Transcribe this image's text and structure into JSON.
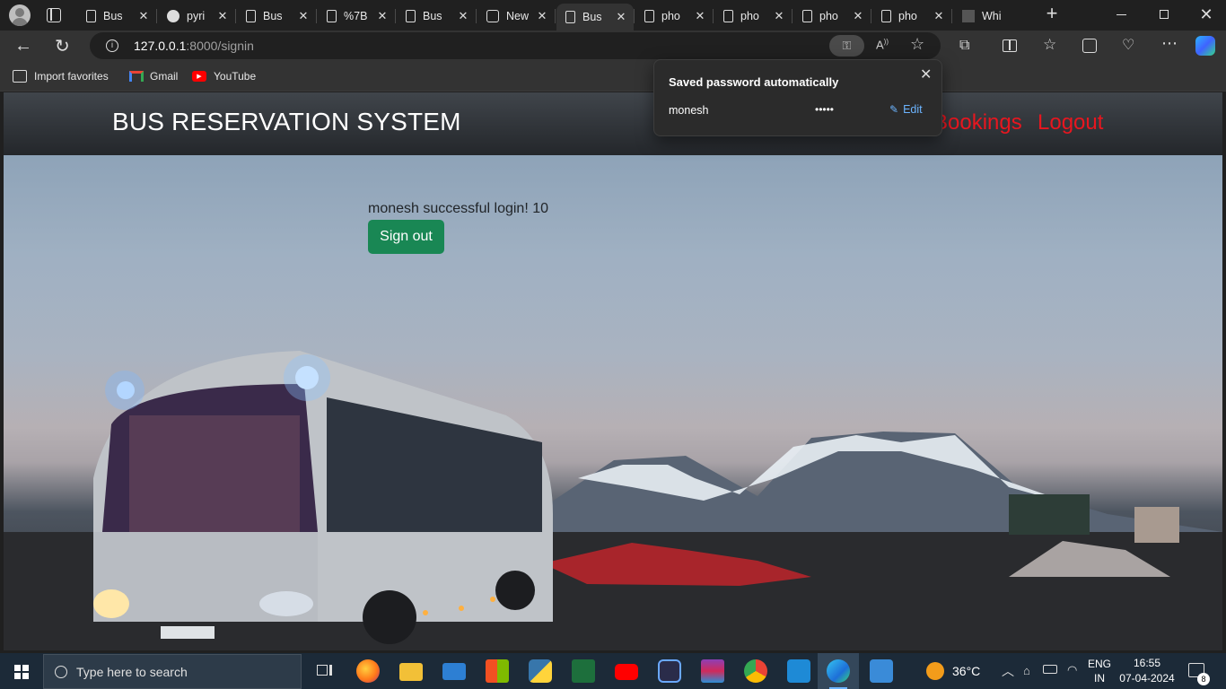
{
  "browser": {
    "tabs": [
      {
        "title": "Bus",
        "icon": "page-icon"
      },
      {
        "title": "pyri",
        "icon": "github-icon"
      },
      {
        "title": "Bus",
        "icon": "page-icon"
      },
      {
        "title": "%7B",
        "icon": "page-icon"
      },
      {
        "title": "Bus",
        "icon": "page-icon"
      },
      {
        "title": "New",
        "icon": "newtab-icon"
      },
      {
        "title": "Bus",
        "icon": "page-icon",
        "active": true
      },
      {
        "title": "pho",
        "icon": "page-icon"
      },
      {
        "title": "pho",
        "icon": "page-icon"
      },
      {
        "title": "pho",
        "icon": "page-icon"
      },
      {
        "title": "pho",
        "icon": "page-icon"
      },
      {
        "title": "Whi",
        "icon": "whi-icon"
      }
    ],
    "url_host": "127.0.0.1",
    "url_path": ":8000/signin",
    "bookmarks": [
      {
        "label": "Import favorites",
        "icon": "import-icon"
      },
      {
        "label": "Gmail",
        "icon": "gmail-icon"
      },
      {
        "label": "YouTube",
        "icon": "youtube-icon"
      }
    ]
  },
  "password_popup": {
    "title": "Saved password automatically",
    "username": "monesh",
    "password_mask": "•••••",
    "edit_label": "Edit"
  },
  "site": {
    "brand": "BUS RESERVATION SYSTEM",
    "nav": [
      "Bookings",
      "Logout"
    ],
    "message": "monesh successful login! 10",
    "signout_label": "Sign out",
    "link_color": "#e8161f",
    "button_color": "#198754"
  },
  "taskbar": {
    "search_placeholder": "Type here to search",
    "weather": "36°C",
    "lang_top": "ENG",
    "lang_bottom": "IN",
    "time": "16:55",
    "date": "07-04-2024",
    "notif_count": "8"
  }
}
